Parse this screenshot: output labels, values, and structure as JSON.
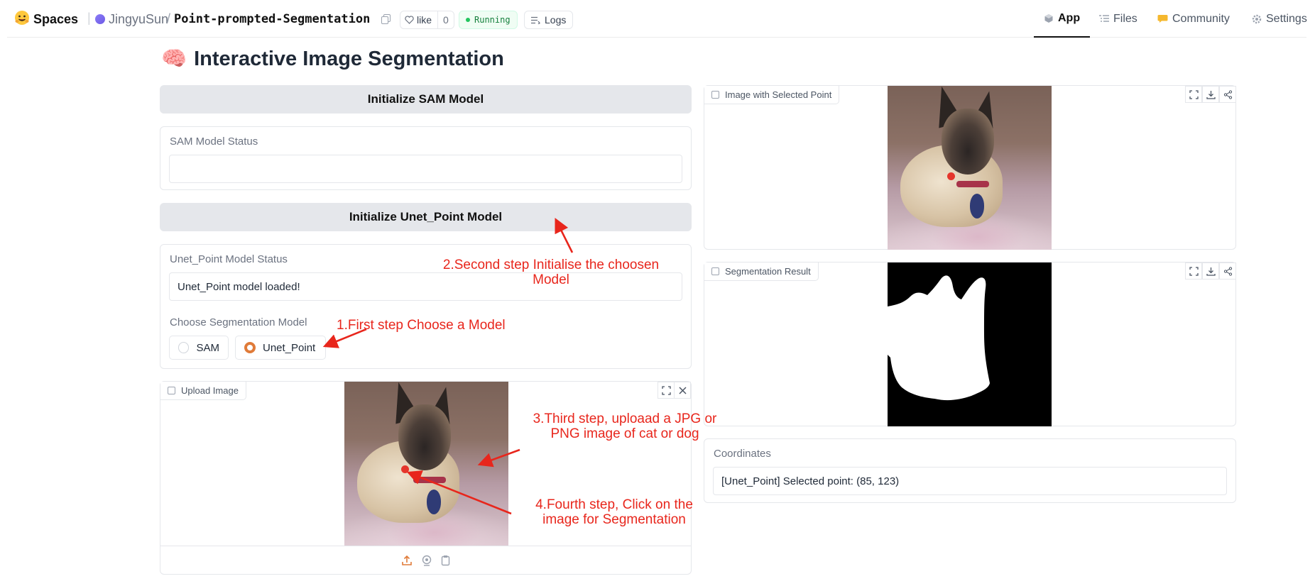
{
  "header": {
    "spaces_label": "Spaces",
    "user": "JingyuSun",
    "separator": "/",
    "repo": "Point-prompted-Segmentation",
    "like_label": "like",
    "like_count": "0",
    "status": "Running",
    "logs_label": "Logs",
    "nav": {
      "app": "App",
      "files": "Files",
      "community": "Community",
      "settings": "Settings"
    }
  },
  "page": {
    "title": "Interactive Image Segmentation",
    "title_emoji": "🧠"
  },
  "left": {
    "init_sam_button": "Initialize SAM Model",
    "sam_status_label": "SAM Model Status",
    "sam_status_value": "",
    "init_unet_button": "Initialize Unet_Point Model",
    "unet_status_label": "Unet_Point Model Status",
    "unet_status_value": "Unet_Point model loaded!",
    "choose_label": "Choose Segmentation Model",
    "options": [
      "SAM",
      "Unet_Point"
    ],
    "selected_option": "Unet_Point",
    "upload_label": "Upload Image"
  },
  "right": {
    "selected_point_label": "Image with Selected Point",
    "segmentation_label": "Segmentation Result",
    "coordinates_label": "Coordinates",
    "coordinates_value": "[Unet_Point] Selected point: (85, 123)"
  },
  "annotations": {
    "step1": "1.First step Choose a Model",
    "step2_line1": "2.Second step Initialise the choosen",
    "step2_line2": "Model",
    "step3_line1": "3.Third step, uploaad a JPG or",
    "step3_line2": "PNG image of cat or dog",
    "step4_line1": "4.Fourth step, Click on the",
    "step4_line2": "image for Segmentation",
    "color": "#e8261c"
  },
  "colors": {
    "accent": "#e07b39",
    "running": "#15803d",
    "button_bg": "#e5e7eb"
  }
}
